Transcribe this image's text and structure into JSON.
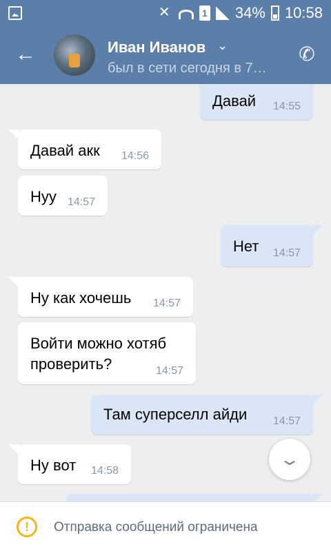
{
  "status_bar": {
    "battery": "34%",
    "time": "10:58",
    "sim": "1",
    "icons": [
      "image-icon",
      "mute-icon",
      "wifi-icon",
      "sim-icon",
      "signal-icon",
      "battery-icon"
    ]
  },
  "header": {
    "back_icon": "←",
    "name": "Иван Иванов",
    "chevron": "⌄",
    "last_seen": "был в сети сегодня в 7…",
    "call_icon": "✆",
    "bg_color": "#5b7fa9"
  },
  "messages": [
    {
      "dir": "out",
      "text": "Давай",
      "time": "14:55"
    },
    {
      "dir": "in",
      "text": "Давай акк",
      "time": "14:56"
    },
    {
      "dir": "in",
      "text": "Нуу",
      "time": "14:57"
    },
    {
      "dir": "out",
      "text": "Нет",
      "time": "14:57"
    },
    {
      "dir": "in",
      "text": "Ну как хочешь",
      "time": "14:57"
    },
    {
      "dir": "in",
      "text": "Войти можно хотяб проверить?",
      "time": "14:57"
    },
    {
      "dir": "out",
      "text": "Там суперселл айди",
      "time": "14:57"
    },
    {
      "dir": "in",
      "text": "Ну вот",
      "time": "14:58"
    }
  ],
  "scroll_down_icon": "⌄",
  "bottom": {
    "warning_icon": "!",
    "text": "Отправка сообщений ограничена"
  }
}
